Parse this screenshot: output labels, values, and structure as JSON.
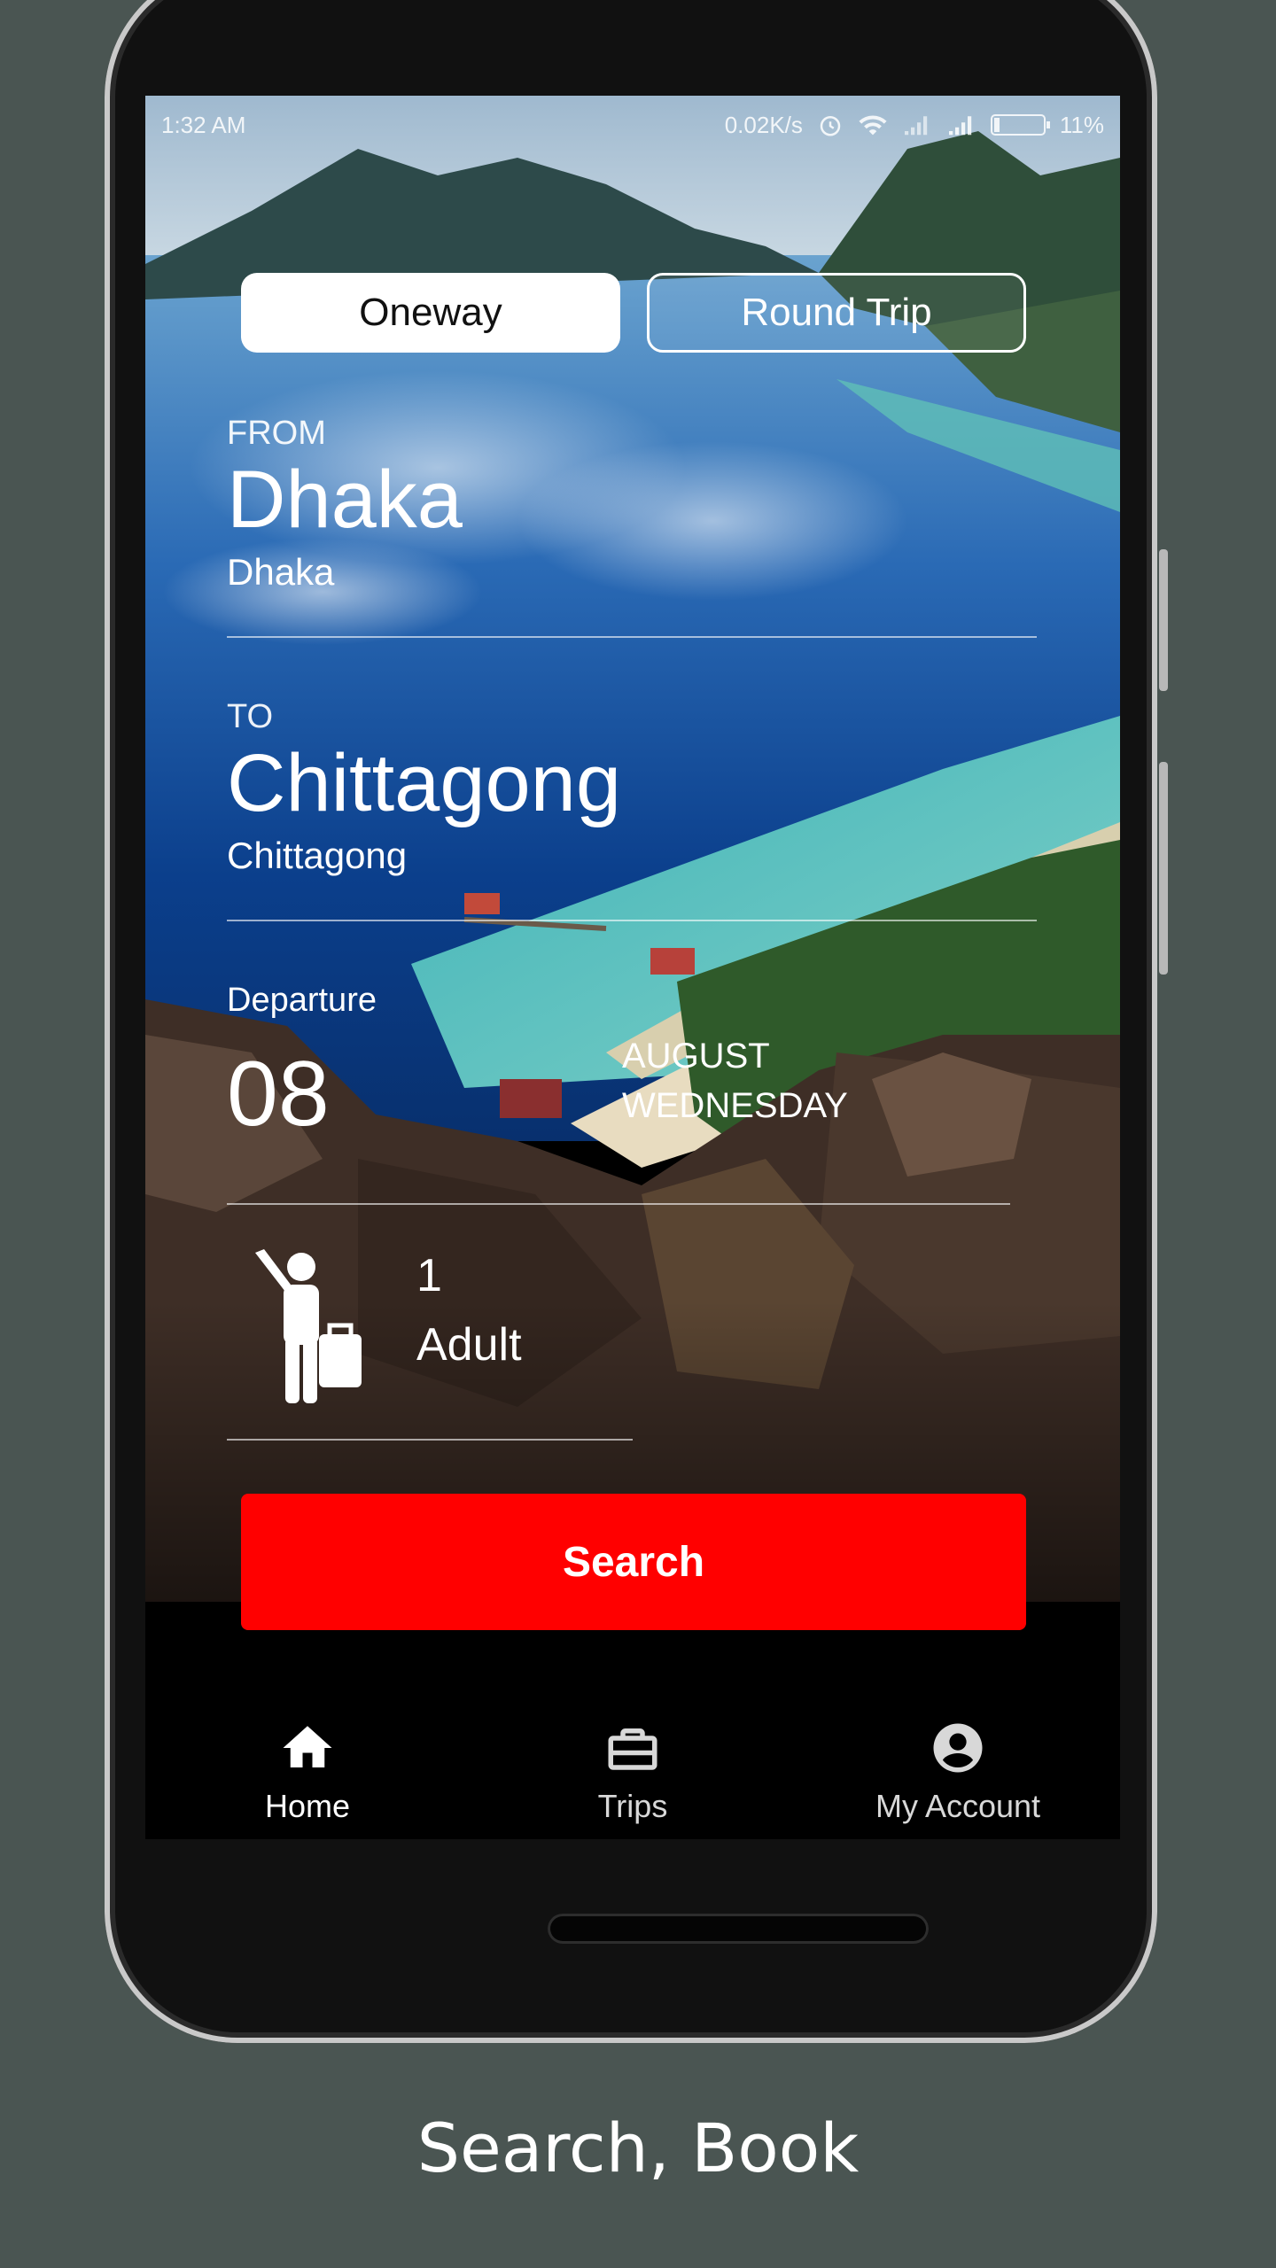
{
  "status_bar": {
    "time": "1:32 AM",
    "network_speed": "0.02K/s",
    "battery_percent": "11%",
    "battery_level": 0.11
  },
  "trip_type": {
    "options": [
      "Oneway",
      "Round Trip"
    ],
    "selected": "Oneway"
  },
  "from": {
    "label": "FROM",
    "city": "Dhaka",
    "station": "Dhaka"
  },
  "to": {
    "label": "TO",
    "city": "Chittagong",
    "station": "Chittagong"
  },
  "departure": {
    "label": "Departure",
    "day": "08",
    "month": "AUGUST",
    "weekday": "WEDNESDAY"
  },
  "passengers": {
    "count": "1",
    "type": "Adult"
  },
  "search_button": "Search",
  "bottom_nav": {
    "items": [
      {
        "label": "Home",
        "icon": "home-icon",
        "active": true
      },
      {
        "label": "Trips",
        "icon": "briefcase-icon",
        "active": false
      },
      {
        "label": "My Account",
        "icon": "account-circle-icon",
        "active": false
      }
    ]
  },
  "caption": "Search, Book",
  "colors": {
    "accent": "#ff0000",
    "page_background": "#4a5552",
    "text": "#ffffff"
  }
}
